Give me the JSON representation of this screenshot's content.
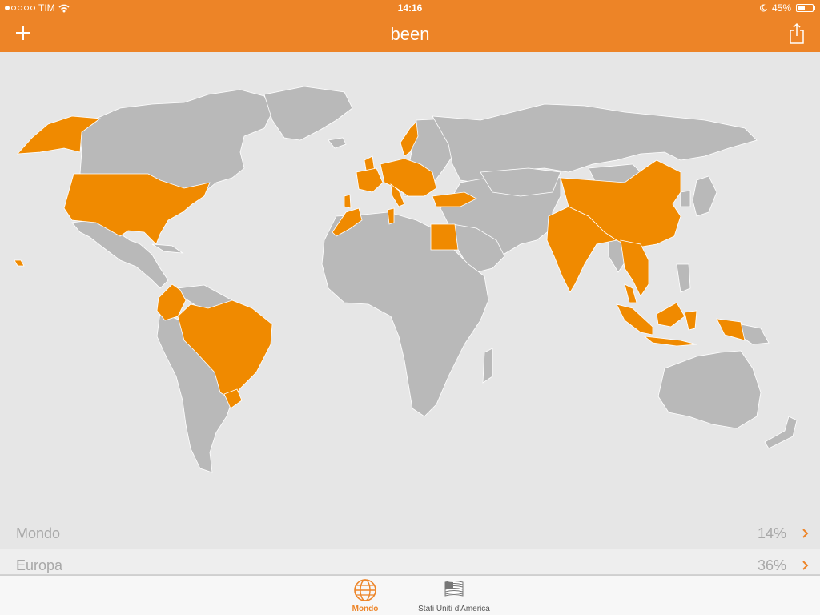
{
  "status_bar": {
    "carrier": "TIM",
    "signal_bars_filled": 1,
    "signal_bars_total": 5,
    "time": "14:16",
    "battery": "45%",
    "battery_level": 0.45
  },
  "navbar": {
    "title": "been",
    "add_icon": "plus-icon",
    "share_icon": "share-icon"
  },
  "colors": {
    "accent": "#ed8427",
    "visited": "#f08a00",
    "unvisited": "#b9b9b9",
    "background": "#e6e6e6"
  },
  "stats": [
    {
      "label": "Mondo",
      "value": "14%"
    },
    {
      "label": "Europa",
      "value": "36%"
    }
  ],
  "tabs": [
    {
      "label": "Mondo",
      "icon": "globe-icon",
      "active": true
    },
    {
      "label": "Stati Uniti d'America",
      "icon": "us-flag-icon",
      "active": false
    }
  ]
}
